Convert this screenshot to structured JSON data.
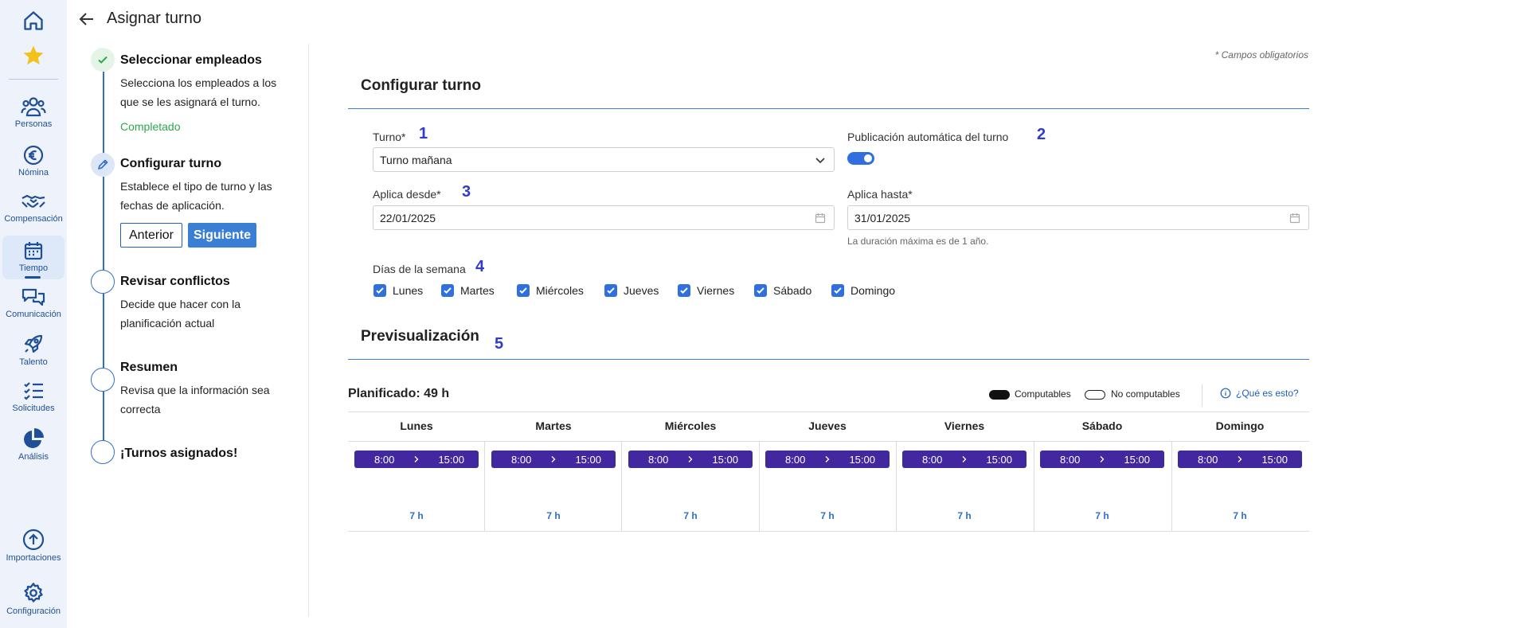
{
  "nav": {
    "items": [
      {
        "key": "home",
        "label": "",
        "icon": "home-icon"
      },
      {
        "key": "favorites",
        "label": "",
        "icon": "star-icon"
      },
      {
        "key": "personas",
        "label": "Personas",
        "icon": "people-icon"
      },
      {
        "key": "nomina",
        "label": "Nómina",
        "icon": "euro-icon"
      },
      {
        "key": "compensacion",
        "label": "Compensación",
        "icon": "handshake-icon"
      },
      {
        "key": "tiempo",
        "label": "Tiempo",
        "icon": "calendar-icon",
        "active": true
      },
      {
        "key": "comunicacion",
        "label": "Comunicación",
        "icon": "chat-icon"
      },
      {
        "key": "talento",
        "label": "Talento",
        "icon": "rocket-icon"
      },
      {
        "key": "solicitudes",
        "label": "Solicitudes",
        "icon": "checklist-icon"
      },
      {
        "key": "analisis",
        "label": "Análisis",
        "icon": "pie-chart-icon"
      },
      {
        "key": "importaciones",
        "label": "Importaciones",
        "icon": "upload-icon"
      },
      {
        "key": "configuracion",
        "label": "Configuración",
        "icon": "gear-icon"
      }
    ]
  },
  "header": {
    "title": "Asignar turno",
    "back_icon": "arrow-left-icon"
  },
  "stepper": {
    "steps": [
      {
        "title": "Seleccionar empleados",
        "desc": "Selecciona los empleados a los que se les asignará el turno.",
        "status": "Completado"
      },
      {
        "title": "Configurar turno",
        "desc": "Establece el tipo de turno y las fechas de aplicación."
      },
      {
        "title": "Revisar conflictos",
        "desc": "Decide que hacer con la planificación actual"
      },
      {
        "title": "Resumen",
        "desc": "Revisa que la información sea correcta"
      },
      {
        "title": "¡Turnos asignados!",
        "desc": ""
      }
    ],
    "prev_label": "Anterior",
    "next_label": "Siguiente"
  },
  "form": {
    "required_note": "* Campos obligatorios",
    "section_title": "Configurar turno",
    "turno_label": "Turno*",
    "turno_value": "Turno mañana",
    "auto_publish_label": "Publicación automática del turno",
    "auto_publish_on": true,
    "from_label": "Aplica desde*",
    "from_value": "22/01/2025",
    "to_label": "Aplica hasta*",
    "to_value": "31/01/2025",
    "duration_hint": "La duración máxima es de 1 año.",
    "weekdays_label": "Días de la semana",
    "weekdays": [
      {
        "label": "Lunes",
        "checked": true
      },
      {
        "label": "Martes",
        "checked": true
      },
      {
        "label": "Miércoles",
        "checked": true
      },
      {
        "label": "Jueves",
        "checked": true
      },
      {
        "label": "Viernes",
        "checked": true
      },
      {
        "label": "Sábado",
        "checked": true
      },
      {
        "label": "Domingo",
        "checked": true
      }
    ]
  },
  "annotations": [
    "1",
    "2",
    "3",
    "4",
    "5"
  ],
  "preview": {
    "section_title": "Previsualización",
    "planned": "Planificado: 49 h",
    "legend_computable": "Computables",
    "legend_non_computable": "No computables",
    "what_is_this": "¿Qué es esto?",
    "days": [
      {
        "name": "Lunes",
        "start": "8:00",
        "end": "15:00",
        "hours": "7 h"
      },
      {
        "name": "Martes",
        "start": "8:00",
        "end": "15:00",
        "hours": "7 h"
      },
      {
        "name": "Miércoles",
        "start": "8:00",
        "end": "15:00",
        "hours": "7 h"
      },
      {
        "name": "Jueves",
        "start": "8:00",
        "end": "15:00",
        "hours": "7 h"
      },
      {
        "name": "Viernes",
        "start": "8:00",
        "end": "15:00",
        "hours": "7 h"
      },
      {
        "name": "Sábado",
        "start": "8:00",
        "end": "15:00",
        "hours": "7 h"
      },
      {
        "name": "Domingo",
        "start": "8:00",
        "end": "15:00",
        "hours": "7 h"
      }
    ]
  },
  "colors": {
    "accent": "#3b7ed6",
    "nav_bg": "#eef3fb",
    "shift": "#41289f",
    "success": "#2ea84a",
    "annotation": "#2e3cc9"
  }
}
